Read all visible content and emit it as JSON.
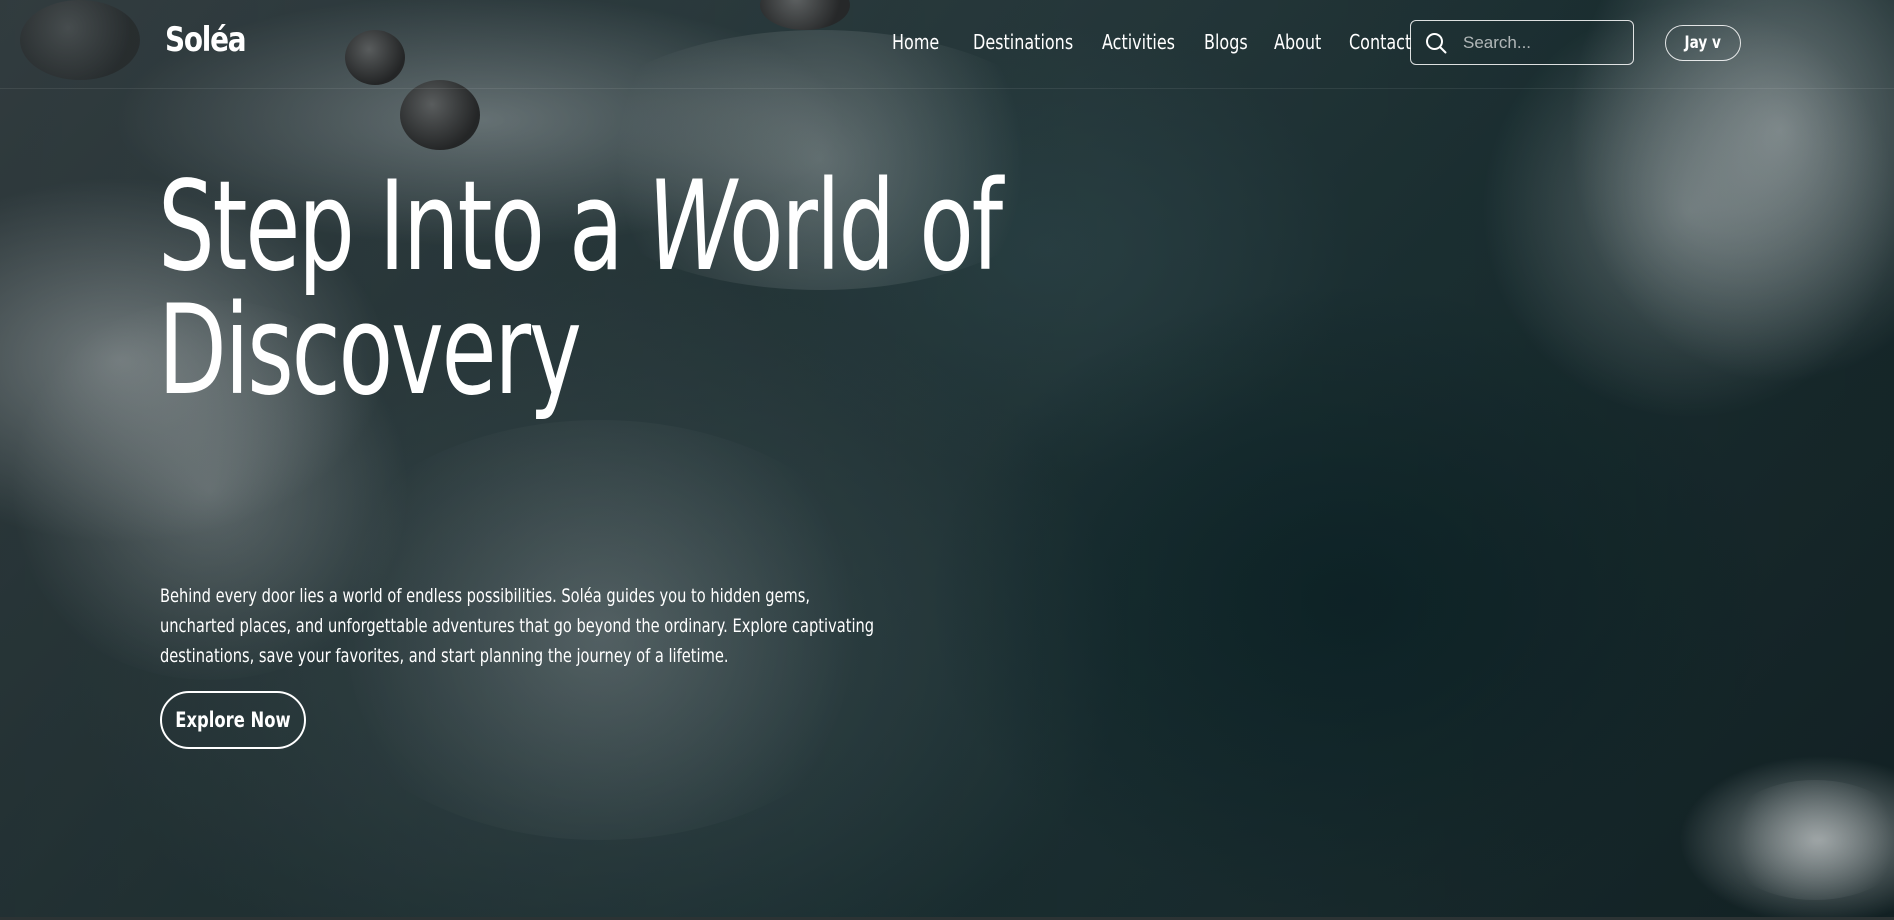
{
  "brand": {
    "logo": "Soléa"
  },
  "nav": {
    "items": [
      {
        "label": "Home"
      },
      {
        "label": "Destinations"
      },
      {
        "label": "Activities"
      },
      {
        "label": "Blogs"
      },
      {
        "label": "About"
      },
      {
        "label": "Contact"
      }
    ]
  },
  "search": {
    "placeholder": "Search...",
    "icon": "search-icon"
  },
  "user": {
    "label": "Jay v"
  },
  "hero": {
    "title_part1": "Step Into a ",
    "title_w": "W",
    "title_part2": "orld of",
    "title_line2": "Discovery",
    "description": "Behind every door lies a world of endless possibilities. Soléa guides you to hidden gems, uncharted places, and unforgettable adventures that go beyond the ordinary. Explore captivating destinations, save your favorites, and start planning the journey of a lifetime.",
    "cta_label": "Explore Now"
  }
}
